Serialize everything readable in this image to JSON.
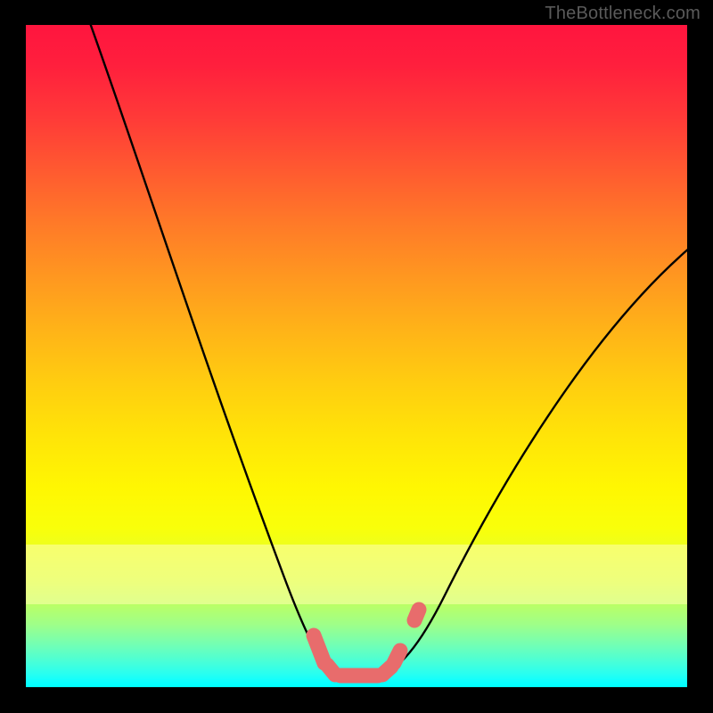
{
  "watermark": "TheBottleneck.com",
  "colors": {
    "frame": "#000000",
    "curve": "#000000",
    "marker": "#e96e6e",
    "gradient_top": "#ff153e",
    "gradient_bottom": "#00ffff"
  },
  "chart_data": {
    "type": "line",
    "title": "",
    "xlabel": "",
    "ylabel": "",
    "xlim": [
      0,
      100
    ],
    "ylim": [
      0,
      100
    ],
    "grid": false,
    "series": [
      {
        "name": "bottleneck-curve",
        "x": [
          10,
          15,
          20,
          25,
          30,
          35,
          40,
          42,
          44,
          46,
          48,
          50,
          52,
          54,
          56,
          60,
          65,
          70,
          75,
          80,
          85,
          90,
          95,
          100
        ],
        "y": [
          100,
          86,
          72,
          58,
          45,
          32,
          18,
          12,
          7,
          3,
          1,
          0,
          0,
          0,
          1,
          5,
          11,
          18,
          26,
          34,
          42,
          50,
          58,
          66
        ]
      }
    ],
    "markers": {
      "name": "highlight-segment",
      "x": [
        44,
        46,
        48,
        50,
        52,
        54,
        56,
        57
      ],
      "y": [
        5,
        1.5,
        0.5,
        0,
        0,
        0.5,
        1,
        2
      ]
    },
    "background_encoding": "vertical color gradient encodes bottleneck severity (red=high, green=none)"
  }
}
